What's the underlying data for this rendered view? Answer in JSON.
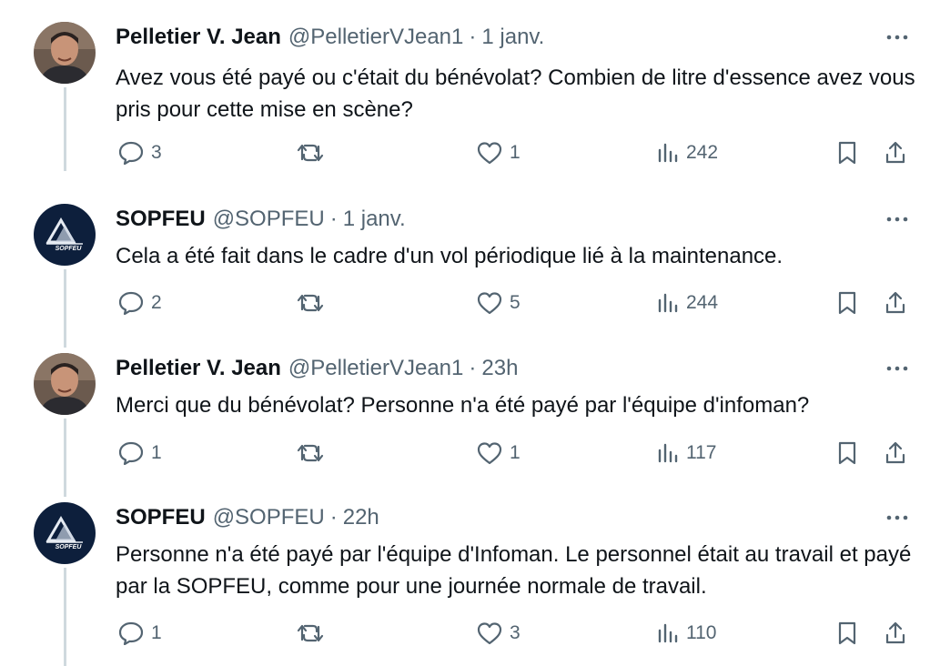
{
  "tweets": [
    {
      "name": "Pelletier V. Jean",
      "handle": "@PelletierVJean1",
      "separator": "·",
      "time": "1 janv.",
      "text": "Avez vous été payé ou c'était du bénévolat? Combien de litre d'essence avez vous pris pour cette mise en scène?",
      "avatar": "person-photo",
      "replies": "3",
      "retweets": "",
      "likes": "1",
      "views": "242"
    },
    {
      "name": "SOPFEU",
      "handle": "@SOPFEU",
      "separator": "·",
      "time": "1 janv.",
      "text": "Cela a été fait dans le cadre d'un vol périodique lié à la maintenance.",
      "avatar": "sopfeu-logo",
      "replies": "2",
      "retweets": "",
      "likes": "5",
      "views": "244"
    },
    {
      "name": "Pelletier V. Jean",
      "handle": "@PelletierVJean1",
      "separator": "·",
      "time": "23h",
      "text": "Merci que du bénévolat? Personne n'a été payé par l'équipe d'infoman?",
      "avatar": "person-photo",
      "replies": "1",
      "retweets": "",
      "likes": "1",
      "views": "117"
    },
    {
      "name": "SOPFEU",
      "handle": "@SOPFEU",
      "separator": "·",
      "time": "22h",
      "text": "Personne n'a été payé par l'équipe d'Infoman. Le personnel était au travail et payé par la SOPFEU, comme pour une journée normale de travail.",
      "avatar": "sopfeu-logo",
      "replies": "1",
      "retweets": "",
      "likes": "3",
      "views": "110"
    }
  ],
  "logo_text": "SOPFEU",
  "colors": {
    "text": "#0f1419",
    "secondary": "#536471",
    "thread_line": "#cfd9de",
    "logo_bg": "#0d1f3c"
  }
}
